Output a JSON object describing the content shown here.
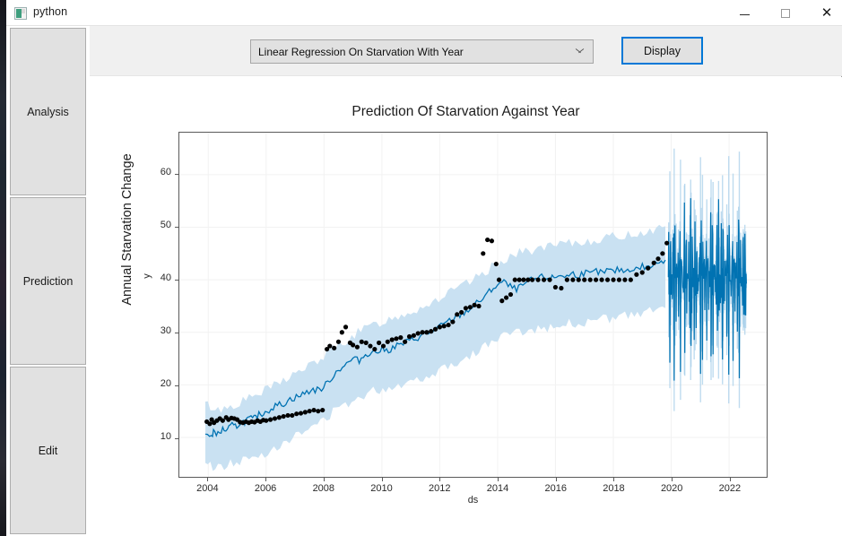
{
  "window": {
    "title": "python",
    "icon": "python-app-icon",
    "controls": {
      "minimize": "—",
      "maximize": "☐",
      "close": "✕"
    }
  },
  "sidebar": {
    "items": [
      {
        "label": "Analysis"
      },
      {
        "label": "Prediction"
      },
      {
        "label": "Edit"
      }
    ]
  },
  "toolbar": {
    "model_select": {
      "selected": "Linear Regression On Starvation With Year",
      "options": [
        "Linear Regression On Starvation With Year"
      ]
    },
    "display_label": "Display"
  },
  "colors": {
    "accent": "#0078d7",
    "forecast_line": "#0072b2",
    "forecast_band": "#c9e1f2",
    "observed_points": "#000000",
    "panel": "#f0f0f0",
    "button_face": "#e1e1e1",
    "axis": "#5a5a5a",
    "grid": "#f2f2f2"
  },
  "chart_data": {
    "type": "line",
    "title": "Prediction Of Starvation Against Year",
    "xlabel": "ds",
    "ylabel": "y",
    "outer_ylabel": "Annual Starvation Change",
    "grid": true,
    "legend": "none",
    "xlim": [
      2003.0,
      2023.3
    ],
    "ylim": [
      2.5,
      68.0
    ],
    "xticks": [
      2004,
      2006,
      2008,
      2010,
      2012,
      2014,
      2016,
      2018,
      2020,
      2022
    ],
    "yticks": [
      10,
      20,
      30,
      40,
      50,
      60
    ],
    "series": [
      {
        "name": "yhat",
        "type": "line",
        "color": "#0072b2",
        "x": [
          2003.9,
          2004.1,
          2004.2,
          2004.35,
          2004.5,
          2004.65,
          2004.8,
          2004.95,
          2005.1,
          2005.25,
          2005.4,
          2005.55,
          2005.7,
          2005.85,
          2006.0,
          2006.2,
          2006.4,
          2006.6,
          2006.8,
          2007.0,
          2007.2,
          2007.4,
          2007.6,
          2007.8,
          2008.0,
          2008.2,
          2008.4,
          2008.6,
          2008.8,
          2009.0,
          2009.2,
          2009.4,
          2009.6,
          2009.8,
          2010.0,
          2010.2,
          2010.4,
          2010.6,
          2010.8,
          2011.0,
          2011.2,
          2011.4,
          2011.6,
          2011.8,
          2012.0,
          2012.2,
          2012.4,
          2012.6,
          2012.8,
          2013.0,
          2013.2,
          2013.4,
          2013.6,
          2013.8,
          2014.0,
          2014.2,
          2014.4,
          2014.6,
          2014.8,
          2015.0,
          2015.2,
          2015.4,
          2015.6,
          2015.8,
          2016.0,
          2016.2,
          2016.4,
          2016.6,
          2016.8,
          2017.0,
          2017.2,
          2017.4,
          2017.6,
          2017.8,
          2018.0,
          2018.2,
          2018.4,
          2018.6,
          2018.8,
          2019.0,
          2019.2,
          2019.4,
          2019.6,
          2019.8
        ],
        "y": [
          11.0,
          9.6,
          11.6,
          10.4,
          11.6,
          11.3,
          12.3,
          12.0,
          12.8,
          13.0,
          13.6,
          13.4,
          14.2,
          14.5,
          15.0,
          15.6,
          16.2,
          16.4,
          17.2,
          17.6,
          18.0,
          18.6,
          19.1,
          19.0,
          19.6,
          21.0,
          22.3,
          23.4,
          24.0,
          25.0,
          24.6,
          25.6,
          26.3,
          26.2,
          26.8,
          26.5,
          27.2,
          27.6,
          28.0,
          28.5,
          28.9,
          29.4,
          29.8,
          30.4,
          31.0,
          31.7,
          32.4,
          33.0,
          33.6,
          34.3,
          35.2,
          36.0,
          37.0,
          38.2,
          39.1,
          39.6,
          38.8,
          38.2,
          38.6,
          39.4,
          40.0,
          40.2,
          40.6,
          40.2,
          40.5,
          41.0,
          40.6,
          41.2,
          40.8,
          41.4,
          41.0,
          41.6,
          41.2,
          41.8,
          41.5,
          42.0,
          41.6,
          42.2,
          42.0,
          42.6,
          42.2,
          43.0,
          43.4,
          44.0
        ]
      },
      {
        "name": "yhat_band",
        "type": "band",
        "color": "#c9e1f2",
        "x": [
          2003.9,
          2004.3,
          2004.8,
          2005.3,
          2005.8,
          2006.3,
          2006.8,
          2007.3,
          2007.8,
          2008.3,
          2008.8,
          2009.3,
          2009.8,
          2010.3,
          2010.8,
          2011.3,
          2011.8,
          2012.3,
          2012.8,
          2013.3,
          2013.8,
          2014.3,
          2014.8,
          2015.3,
          2015.8,
          2016.3,
          2016.8,
          2017.3,
          2017.8,
          2018.3,
          2018.8,
          2019.3,
          2019.8
        ],
        "lower": [
          5.0,
          4.2,
          5.0,
          5.8,
          6.6,
          8.2,
          9.6,
          11.0,
          12.6,
          14.8,
          16.4,
          18.0,
          19.0,
          19.6,
          20.4,
          21.2,
          22.4,
          23.6,
          25.0,
          26.4,
          28.2,
          29.6,
          30.0,
          30.6,
          31.0,
          31.6,
          31.8,
          32.2,
          32.6,
          33.0,
          33.4,
          34.0,
          34.8
        ],
        "upper": [
          16.4,
          15.2,
          16.0,
          17.2,
          18.4,
          20.0,
          21.6,
          23.0,
          24.6,
          26.8,
          28.6,
          30.4,
          31.6,
          32.6,
          33.6,
          34.6,
          36.0,
          37.4,
          38.8,
          40.4,
          42.4,
          44.2,
          45.2,
          45.8,
          46.2,
          46.8,
          47.0,
          47.6,
          48.0,
          48.4,
          48.8,
          49.4,
          50.2
        ]
      },
      {
        "name": "y_observed",
        "type": "scatter",
        "color": "#000000",
        "x": [
          2003.95,
          2004.05,
          2004.12,
          2004.2,
          2004.3,
          2004.4,
          2004.5,
          2004.62,
          2004.7,
          2004.8,
          2004.9,
          2005.0,
          2005.1,
          2005.2,
          2005.3,
          2005.4,
          2005.5,
          2005.6,
          2005.7,
          2005.8,
          2005.9,
          2006.0,
          2006.15,
          2006.3,
          2006.45,
          2006.6,
          2006.75,
          2006.9,
          2007.05,
          2007.2,
          2007.35,
          2007.5,
          2007.65,
          2007.8,
          2007.95,
          2008.1,
          2008.2,
          2008.35,
          2008.5,
          2008.62,
          2008.75,
          2008.9,
          2009.0,
          2009.15,
          2009.3,
          2009.45,
          2009.6,
          2009.75,
          2009.9,
          2010.05,
          2010.2,
          2010.35,
          2010.5,
          2010.65,
          2010.8,
          2010.95,
          2011.1,
          2011.25,
          2011.4,
          2011.55,
          2011.7,
          2011.85,
          2012.0,
          2012.15,
          2012.3,
          2012.45,
          2012.6,
          2012.75,
          2012.9,
          2013.05,
          2013.2,
          2013.35,
          2013.5,
          2013.65,
          2013.8,
          2013.95,
          2014.05,
          2014.15,
          2014.3,
          2014.45,
          2014.6,
          2014.75,
          2014.9,
          2015.05,
          2015.2,
          2015.4,
          2015.6,
          2015.8,
          2016.0,
          2016.2,
          2016.4,
          2016.6,
          2016.8,
          2017.0,
          2017.2,
          2017.4,
          2017.6,
          2017.8,
          2018.0,
          2018.2,
          2018.4,
          2018.6,
          2018.8,
          2019.0,
          2019.2,
          2019.4,
          2019.55,
          2019.7,
          2019.85
        ],
        "y": [
          13.0,
          12.6,
          13.4,
          12.8,
          13.2,
          13.6,
          13.2,
          13.8,
          13.4,
          13.7,
          13.6,
          13.4,
          12.9,
          12.8,
          13.0,
          12.8,
          13.0,
          12.9,
          13.2,
          13.0,
          13.3,
          13.2,
          13.4,
          13.6,
          13.8,
          14.0,
          14.2,
          14.2,
          14.5,
          14.6,
          14.8,
          15.0,
          15.2,
          15.0,
          15.2,
          26.8,
          27.4,
          27.0,
          28.2,
          30.0,
          31.0,
          28.0,
          27.6,
          27.2,
          28.2,
          28.0,
          27.4,
          26.8,
          28.0,
          27.4,
          28.2,
          28.6,
          28.8,
          29.0,
          28.2,
          29.2,
          29.4,
          29.8,
          30.0,
          30.0,
          30.2,
          30.6,
          31.0,
          31.2,
          31.4,
          32.0,
          33.4,
          33.8,
          34.6,
          34.8,
          35.2,
          35.0,
          45.0,
          47.6,
          47.4,
          43.0,
          40.0,
          36.0,
          36.6,
          37.2,
          40.0,
          40.0,
          40.0,
          40.0,
          40.0,
          40.0,
          40.0,
          40.0,
          38.6,
          38.4,
          40.0,
          40.0,
          40.0,
          40.0,
          40.0,
          40.0,
          40.0,
          40.0,
          40.0,
          40.0,
          40.0,
          40.0,
          41.0,
          41.4,
          42.2,
          43.2,
          44.0,
          45.0,
          47.0
        ]
      },
      {
        "name": "forecast_oscillation",
        "type": "line",
        "color": "#0072b2",
        "note": "dense high-frequency forecast 2019.9-2022.6, amplitude roughly 20 to 60",
        "x_range": [
          2019.9,
          2022.6
        ],
        "y_range": [
          20.0,
          61.0
        ],
        "band_range": [
          14.0,
          66.0
        ]
      }
    ]
  }
}
